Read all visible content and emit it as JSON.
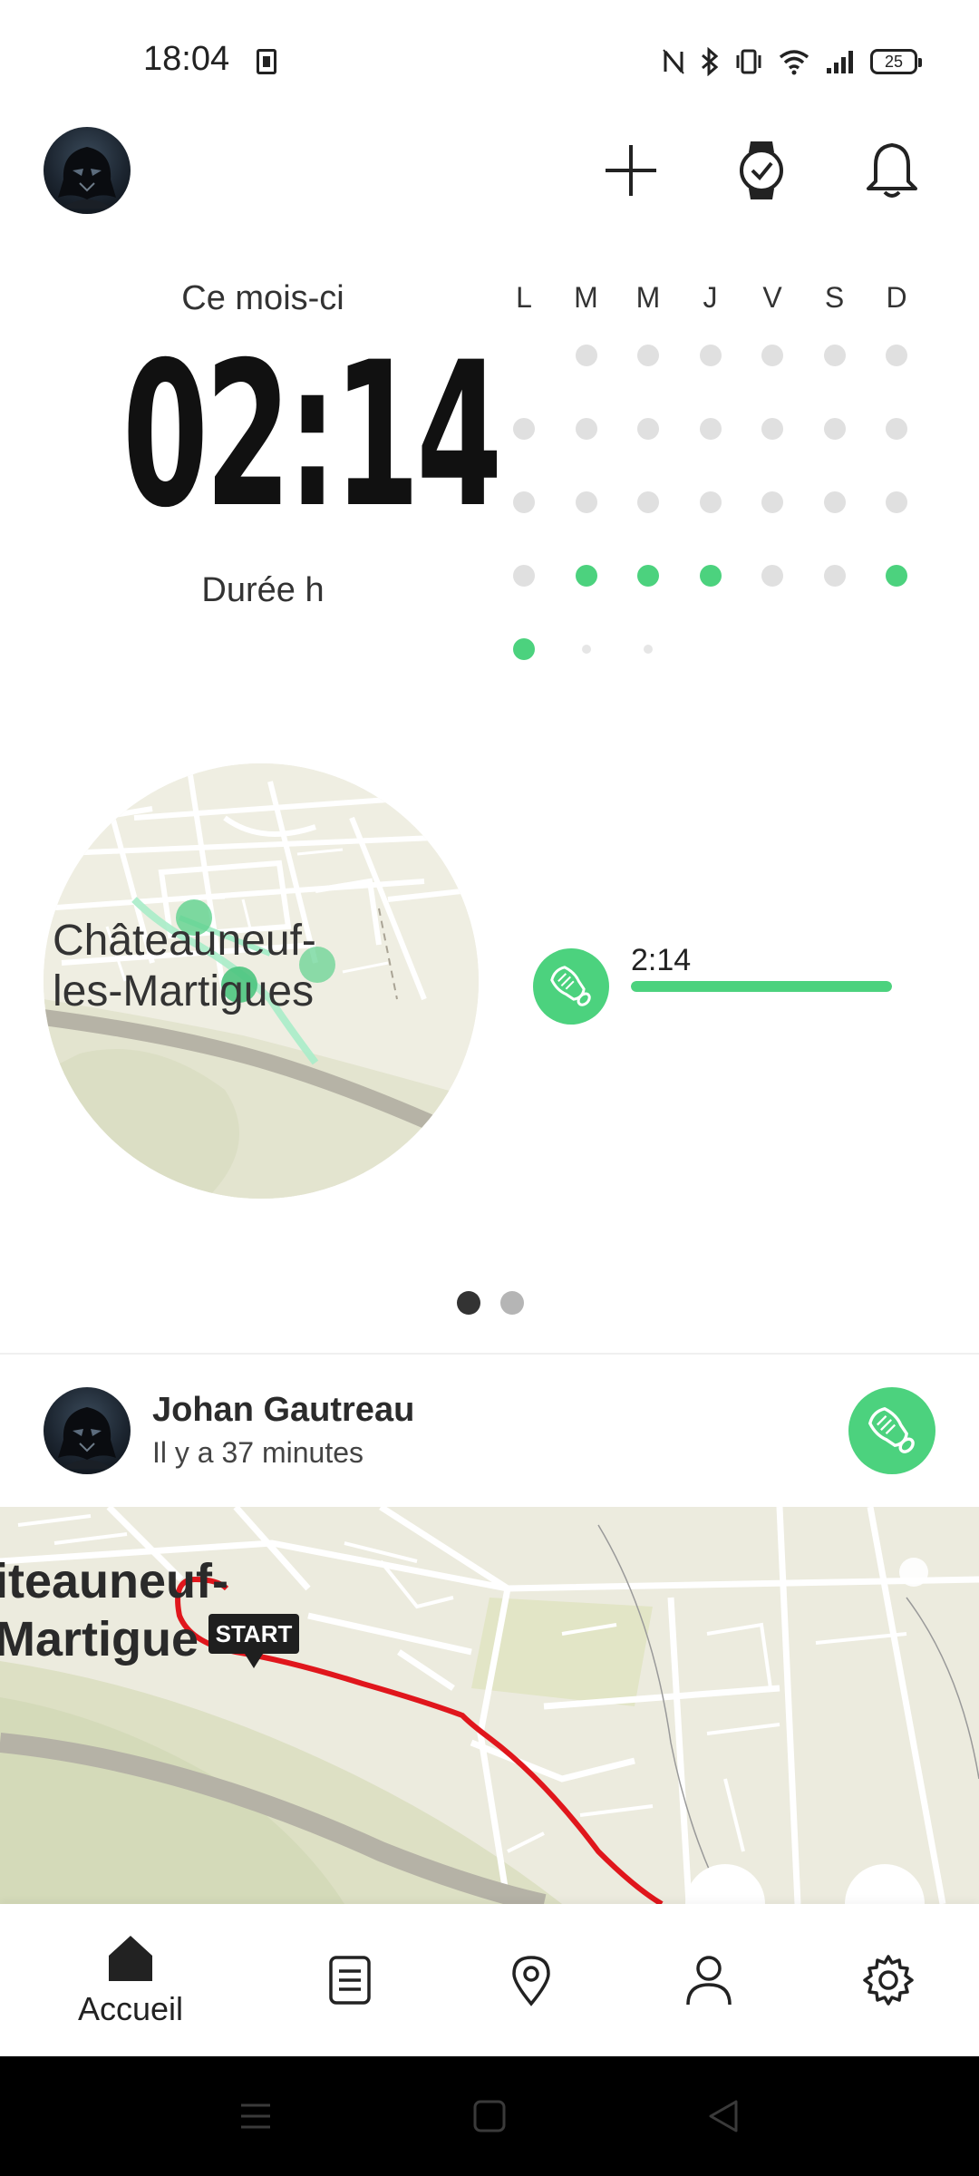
{
  "status_bar": {
    "time": "18:04",
    "battery": "25",
    "icons": [
      "nfc-icon",
      "bluetooth-icon",
      "vibrate-icon",
      "wifi-icon",
      "signal-icon",
      "battery-icon"
    ]
  },
  "top_bar": {
    "actions": [
      "add-icon",
      "watch-icon",
      "bell-icon"
    ]
  },
  "summary": {
    "period_label": "Ce mois-ci",
    "value": "02:14",
    "unit_label": "Durée h"
  },
  "calendar": {
    "weekdays": [
      "L",
      "M",
      "M",
      "J",
      "V",
      "S",
      "D"
    ],
    "weeks": [
      [
        null,
        0,
        0,
        0,
        0,
        0,
        0
      ],
      [
        0,
        0,
        0,
        0,
        0,
        0,
        0
      ],
      [
        0,
        0,
        0,
        0,
        0,
        0,
        0
      ],
      [
        0,
        1,
        1,
        1,
        0,
        0,
        1
      ],
      [
        1,
        "future",
        "future",
        null,
        null,
        null,
        null
      ]
    ],
    "active_color": "#4cd27e",
    "inactive_color": "#e0e0e0"
  },
  "card": {
    "map_label_line1": "Châteauneuf-",
    "map_label_line2": "les-Martigues",
    "activity_icon": "running-shoe-icon",
    "duration": "2:14",
    "progress": 1.0
  },
  "pager": {
    "count": 2,
    "active": 0
  },
  "feed": {
    "user_name": "Johan Gautreau",
    "time_ago": "Il y a 37 minutes",
    "sport_icon": "running-shoe-icon",
    "map_label_line1": "iteauneuf-",
    "map_label_line2": "Martigue",
    "start_label": "START",
    "route_color": "#e0161c"
  },
  "bottom_nav": {
    "home_label": "Accueil",
    "items": [
      "home-icon",
      "journal-icon",
      "map-pin-icon",
      "profile-icon",
      "settings-icon"
    ]
  },
  "colors": {
    "accent": "#4cd27e",
    "text": "#222222"
  }
}
